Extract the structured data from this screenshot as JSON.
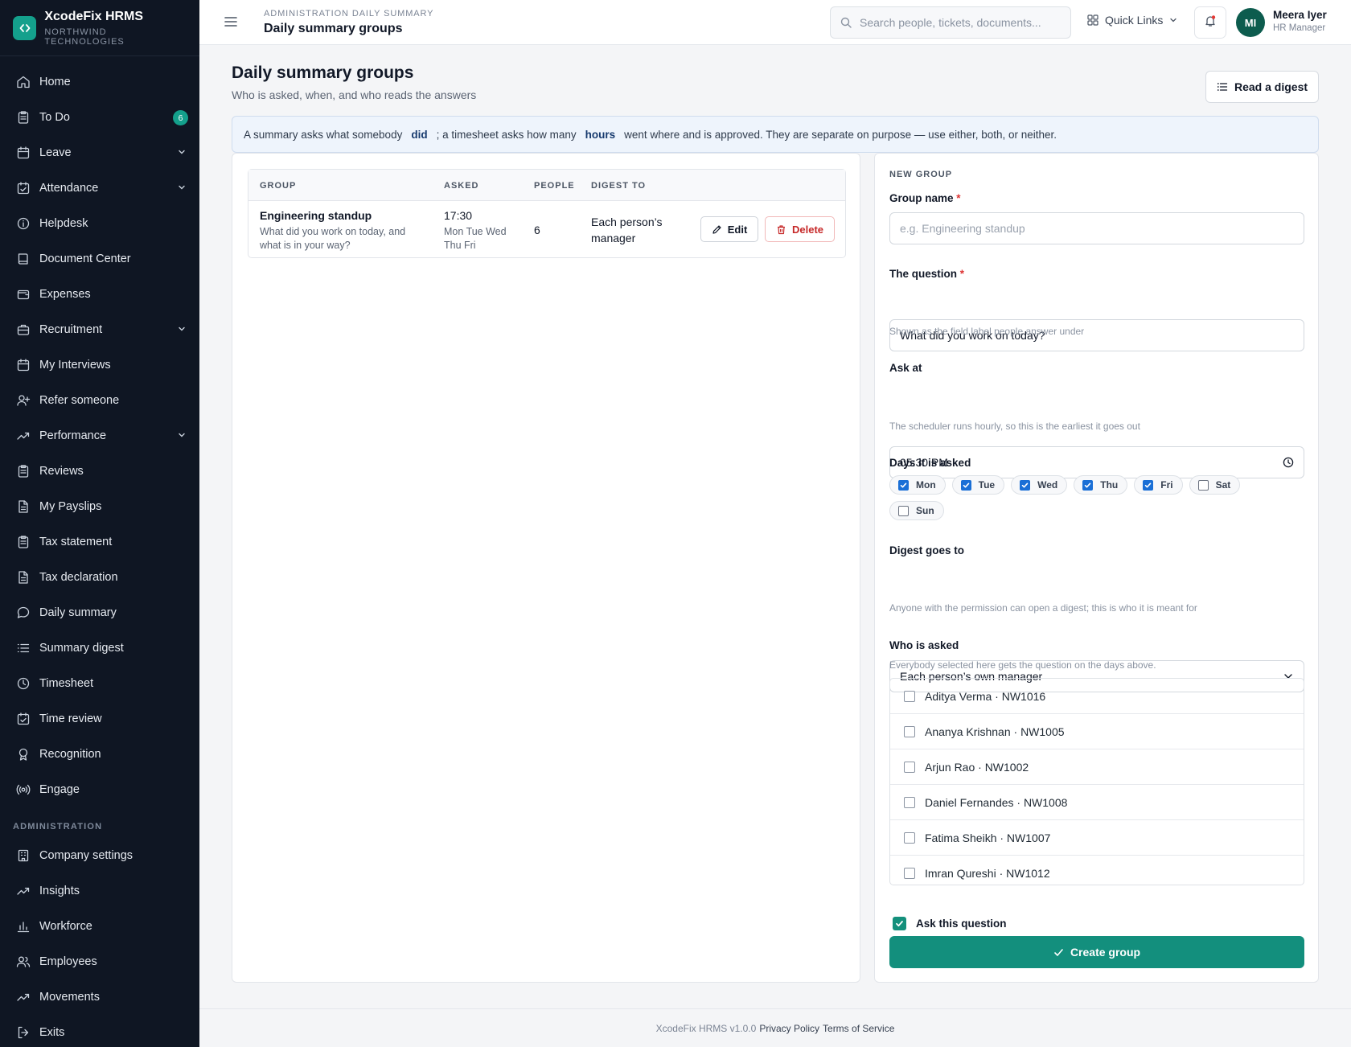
{
  "brand": {
    "name": "XcodeFix HRMS",
    "company": "NORTHWIND TECHNOLOGIES",
    "accent": "#14a08c"
  },
  "sidebar": {
    "items": [
      {
        "label": "Home",
        "icon": "home-icon"
      },
      {
        "label": "To Do",
        "icon": "clipboard-icon",
        "badge": "6"
      },
      {
        "label": "Leave",
        "icon": "calendar-icon",
        "expandable": true
      },
      {
        "label": "Attendance",
        "icon": "calendar-check-icon",
        "expandable": true
      },
      {
        "label": "Helpdesk",
        "icon": "info-icon"
      },
      {
        "label": "Document Center",
        "icon": "book-icon"
      },
      {
        "label": "Expenses",
        "icon": "wallet-icon"
      },
      {
        "label": "Recruitment",
        "icon": "briefcase-icon",
        "expandable": true
      },
      {
        "label": "My Interviews",
        "icon": "calendar-icon"
      },
      {
        "label": "Refer someone",
        "icon": "user-plus-icon"
      },
      {
        "label": "Performance",
        "icon": "trending-up-icon",
        "expandable": true
      },
      {
        "label": "Reviews",
        "icon": "clipboard-icon"
      },
      {
        "label": "My Payslips",
        "icon": "file-icon"
      },
      {
        "label": "Tax statement",
        "icon": "clipboard-icon"
      },
      {
        "label": "Tax declaration",
        "icon": "file-icon"
      },
      {
        "label": "Daily summary",
        "icon": "message-icon"
      },
      {
        "label": "Summary digest",
        "icon": "list-icon"
      },
      {
        "label": "Timesheet",
        "icon": "clock-icon"
      },
      {
        "label": "Time review",
        "icon": "calendar-check-icon"
      },
      {
        "label": "Recognition",
        "icon": "award-icon"
      },
      {
        "label": "Engage",
        "icon": "radio-icon"
      }
    ],
    "admin_section": "ADMINISTRATION",
    "admin_items": [
      {
        "label": "Company settings",
        "icon": "building-icon"
      },
      {
        "label": "Insights",
        "icon": "trending-up-icon"
      },
      {
        "label": "Workforce",
        "icon": "bar-chart-icon"
      },
      {
        "label": "Employees",
        "icon": "users-icon"
      },
      {
        "label": "Movements",
        "icon": "trending-up-icon"
      },
      {
        "label": "Exits",
        "icon": "log-out-icon"
      }
    ]
  },
  "header": {
    "breadcrumb": "ADMINISTRATION DAILY SUMMARY",
    "title": "Daily summary groups",
    "search_placeholder": "Search people, tickets, documents...",
    "quick_links": "Quick Links",
    "user": {
      "initials": "MI",
      "name": "Meera Iyer",
      "role": "HR Manager"
    }
  },
  "page": {
    "title": "Daily summary groups",
    "subtitle": "Who is asked, when, and who reads the answers",
    "digest_button": "Read a digest",
    "banner": {
      "part1": "A summary asks what somebody",
      "em1": "did",
      "part2": "; a timesheet asks how many",
      "em2": "hours",
      "part3": "went where and is approved. They are separate on purpose — use either, both, or neither."
    }
  },
  "table": {
    "headers": [
      "GROUP",
      "ASKED",
      "PEOPLE",
      "DIGEST TO"
    ],
    "rows": [
      {
        "name": "Engineering standup",
        "question": "What did you work on today, and what is in your way?",
        "time": "17:30",
        "days": "Mon Tue Wed Thu Fri",
        "people": "6",
        "digest_to": "Each person’s manager",
        "edit_label": "Edit",
        "delete_label": "Delete"
      }
    ]
  },
  "form": {
    "section": "NEW GROUP",
    "group_name": {
      "label": "Group name",
      "required": "*",
      "placeholder": "e.g. Engineering standup"
    },
    "question": {
      "label": "The question",
      "required": "*",
      "value": "What did you work on today?",
      "hint": "Shown as the field label people answer under"
    },
    "ask_at": {
      "label": "Ask at",
      "value": "05:30 PM",
      "hint": "The scheduler runs hourly, so this is the earliest it goes out"
    },
    "days": {
      "label": "Days it is asked",
      "options": [
        {
          "label": "Mon",
          "checked": true
        },
        {
          "label": "Tue",
          "checked": true
        },
        {
          "label": "Wed",
          "checked": true
        },
        {
          "label": "Thu",
          "checked": true
        },
        {
          "label": "Fri",
          "checked": true
        },
        {
          "label": "Sat",
          "checked": false
        },
        {
          "label": "Sun",
          "checked": false
        }
      ]
    },
    "digest": {
      "label": "Digest goes to",
      "value": "Each person’s own manager",
      "hint": "Anyone with the permission can open a digest; this is who it is meant for"
    },
    "who": {
      "label": "Who is asked",
      "hint": "Everybody selected here gets the question on the days above.",
      "people": [
        "Aditya Verma · NW1016",
        "Ananya Krishnan · NW1005",
        "Arjun Rao · NW1002",
        "Daniel Fernandes · NW1008",
        "Fatima Sheikh · NW1007",
        "Imran Qureshi · NW1012"
      ]
    },
    "ask_toggle": {
      "label": "Ask this question",
      "checked": true
    },
    "submit": "Create group"
  },
  "footer": {
    "version": "XcodeFix HRMS v1.0.0",
    "privacy": "Privacy Policy",
    "terms": "Terms of Service"
  }
}
